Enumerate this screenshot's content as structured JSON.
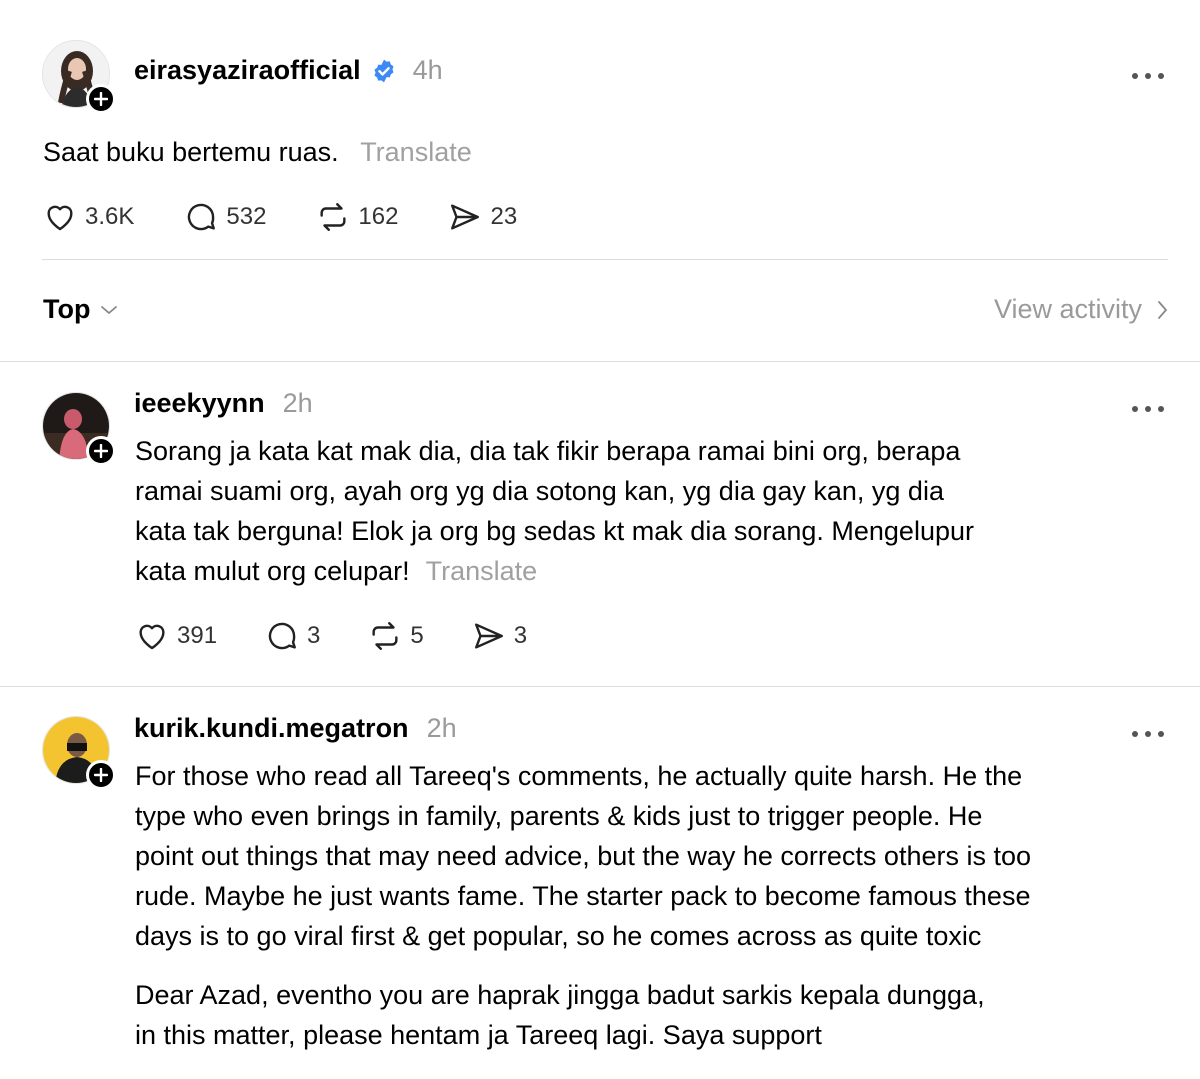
{
  "post": {
    "username": "eirasyaziraofficial",
    "verified_icon": "verified-badge-icon",
    "time": "4h",
    "text": "Saat buku bertemu ruas.",
    "translate": "Translate",
    "likes": "3.6K",
    "comments": "532",
    "reposts": "162",
    "shares": "23"
  },
  "sort": {
    "label": "Top",
    "view_activity": "View activity"
  },
  "replies": [
    {
      "username": "ieeekyynn",
      "time": "2h",
      "lines": [
        "Sorang ja kata kat mak dia, dia tak fikir berapa ramai bini org, berapa",
        "ramai suami org, ayah org yg dia sotong kan, yg dia gay kan, yg dia",
        "kata tak berguna! Elok ja org bg sedas kt mak dia sorang. Mengelupur",
        "kata mulut org celupar!"
      ],
      "translate": "Translate",
      "likes": "391",
      "comments": "3",
      "reposts": "5",
      "shares": "3"
    },
    {
      "username": "kurik.kundi.megatron",
      "time": "2h",
      "lines": [
        "For those who read all Tareeq's comments, he actually quite harsh. He the",
        "type who even brings in family, parents & kids just to trigger people. He",
        "point out things that may need advice, but the way he corrects others is too",
        "rude. Maybe he just wants fame. The starter pack to become famous these",
        "days is to go viral first & get popular, so he comes across as quite toxic"
      ],
      "lines2": [
        "Dear Azad, eventho you are haprak jingga badut sarkis kepala dungga,",
        "in this matter, please hentam ja Tareeq lagi. Saya support"
      ]
    }
  ],
  "colors": {
    "verified": "#3d8af7",
    "secondary_text": "#9a9a9a",
    "divider": "#dcdcdc"
  }
}
